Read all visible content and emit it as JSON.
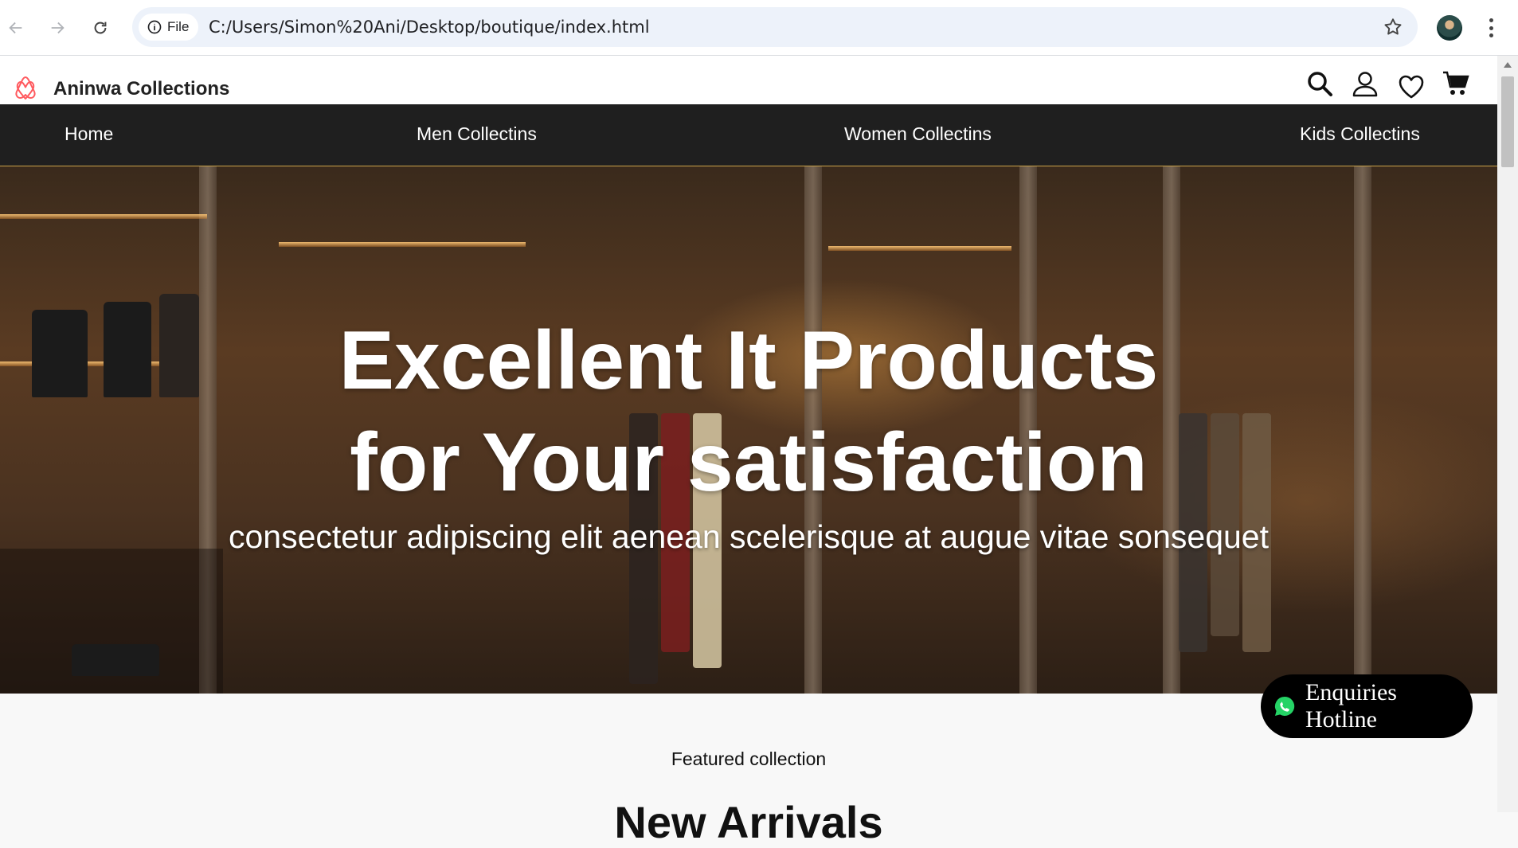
{
  "browser": {
    "chip_label": "File",
    "url": "C:/Users/Simon%20Ani/Desktop/boutique/index.html"
  },
  "site": {
    "brand": "Aninwa Collections",
    "nav": [
      "Home",
      "Men Collectins",
      "Women Collectins",
      "Kids Collectins"
    ]
  },
  "hero": {
    "title_line1": "Excellent It Products",
    "title_line2": "for Your satisfaction",
    "subtitle": "consectetur adipiscing elit aenean scelerisque at augue vitae sonsequet"
  },
  "hotline": {
    "label": "Enquiries Hotline"
  },
  "section": {
    "featured": "Featured collection",
    "heading": "New Arrivals"
  },
  "colors": {
    "nav_bg": "#1f1f1f",
    "logo": "#ff5a5f",
    "whatsapp": "#25d366"
  }
}
